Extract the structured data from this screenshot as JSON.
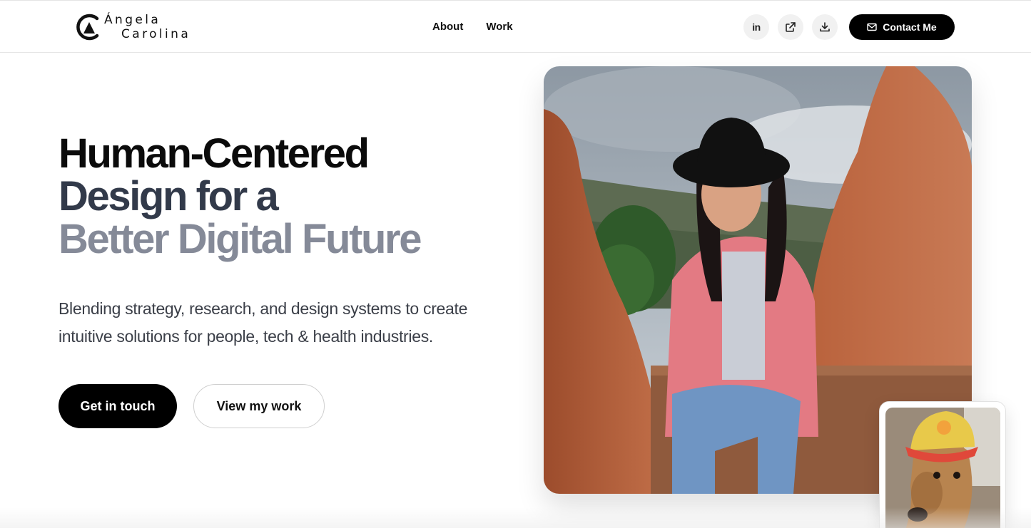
{
  "brand": {
    "name_line1": "Ángela",
    "name_line2": "Carolina"
  },
  "nav": {
    "items": [
      {
        "label": "About"
      },
      {
        "label": "Work"
      }
    ]
  },
  "header_actions": {
    "icons": [
      "linkedin-icon",
      "external-link-icon",
      "download-icon"
    ],
    "linkedin_glyph": "in",
    "contact_label": "Contact Me"
  },
  "hero": {
    "headline_line1": "Human-Centered",
    "headline_line2": "Design for a",
    "headline_line3": "Better Digital Future",
    "subtext_line1": "Blending strategy, research, and design systems to create",
    "subtext_line2": "intuitive solutions for people, tech & health industries.",
    "primary_cta": "Get in touch",
    "secondary_cta": "View my work"
  },
  "colors": {
    "accent": "#000000",
    "headline_dark": "#0b0b0b",
    "headline_mid": "#323a4a",
    "headline_light": "#858a98",
    "body_text": "#3b3f48"
  }
}
